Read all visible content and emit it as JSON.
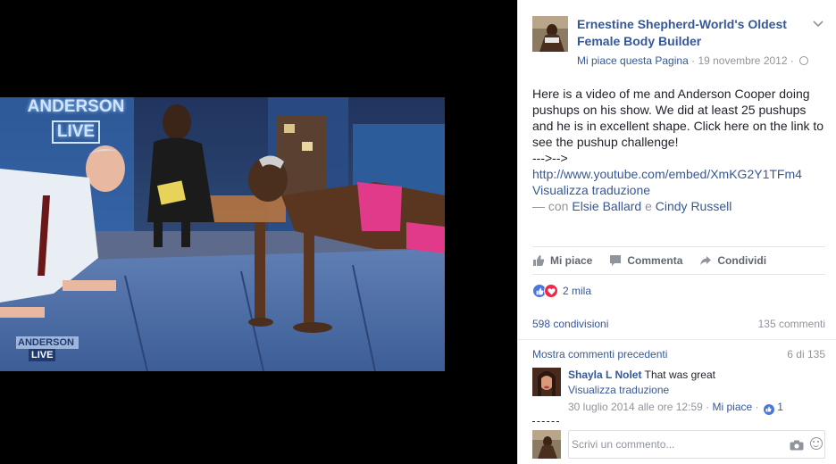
{
  "video": {
    "logo_top": "ANDERSON",
    "logo_top_sub": "LIVE",
    "logo_bottom": "ANDERSON",
    "logo_bottom_sub": "LIVE"
  },
  "post_header": {
    "page_name": "Ernestine Shepherd-World's Oldest Female Body Builder",
    "like_page": "Mi piace questa Pagina",
    "separator": "·",
    "date": "19 novembre 2012",
    "separator2": "·",
    "privacy_icon": "globe-icon",
    "menu_icon": "chevron-down-icon"
  },
  "post": {
    "text": "Here is a video of me and Anderson Cooper doing pushups on his show. We did at least 25 pushups and he is in excellent shape. Click here on the link to see the pushup challenge!",
    "arrow_prefix": "--->-->",
    "link": "http://www.youtube.com/embed/XmKG2Y1TFm4",
    "translate": "Visualizza traduzione",
    "with_prefix": "— con",
    "tagged": [
      "Elsie Ballard",
      "Cindy Russell"
    ],
    "and_word": "e"
  },
  "actions": {
    "like": "Mi piace",
    "comment": "Commenta",
    "share": "Condividi"
  },
  "reactions": {
    "count": "2 mila",
    "shares": "598 condivisioni",
    "comments": "135 commenti"
  },
  "comments": {
    "more_label": "Mostra commenti precedenti",
    "page_count": "6 di 135",
    "items": [
      {
        "author": "Shayla L Nolet",
        "text": "That was great",
        "translate": "Visualizza traduzione",
        "time": "30 luglio 2014 alle ore 12:59",
        "dot": "·",
        "like": "Mi piace",
        "dot2": "·",
        "likes": "1"
      }
    ]
  },
  "composer": {
    "placeholder": "Scrivi un commento...",
    "camera_icon": "camera-icon",
    "emoji_icon": "emoji-icon"
  },
  "colors": {
    "link": "#365899",
    "muted": "#90949c",
    "like_blue": "#4a78d8",
    "love_red": "#f0284a"
  }
}
